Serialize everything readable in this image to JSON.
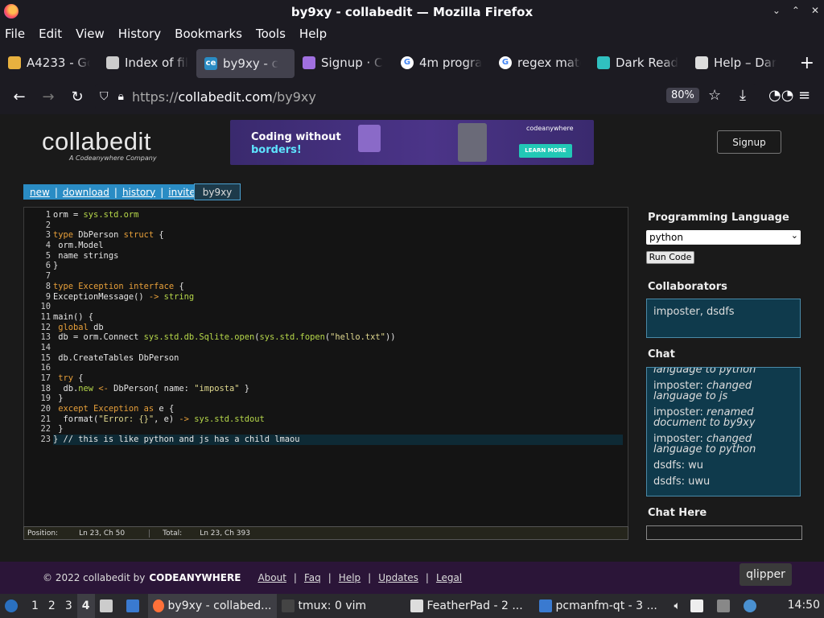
{
  "window": {
    "title": "by9xy - collabedit — Mozilla Firefox",
    "controls": [
      "⌄",
      "⌃",
      "✕"
    ]
  },
  "menubar": [
    "File",
    "Edit",
    "View",
    "History",
    "Bookmarks",
    "Tools",
    "Help"
  ],
  "tabs": [
    {
      "label": "A4233 - Go",
      "icon": "map-pin-icon",
      "color": "#e8b13f",
      "active": false
    },
    {
      "label": "Index of fil",
      "icon": "file-icon",
      "color": "#cccccc",
      "active": false
    },
    {
      "label": "by9xy - c",
      "icon": "ce",
      "color": "#2a8cc4",
      "active": true
    },
    {
      "label": "Signup · C",
      "icon": "cube-icon",
      "color": "#a070e0",
      "active": false
    },
    {
      "label": "4m progra",
      "icon": "G",
      "color": "#ffffff",
      "active": false
    },
    {
      "label": "regex matc",
      "icon": "G",
      "color": "#ffffff",
      "active": false
    },
    {
      "label": "Dark Read",
      "icon": "dark-reader-icon",
      "color": "#30c0c0",
      "active": false
    },
    {
      "label": "Help – Dar",
      "icon": "glasses-icon",
      "color": "#dddddd",
      "active": false
    }
  ],
  "navbar": {
    "url_prefix": "https://",
    "url_host": "collabedit.com",
    "url_path": "/by9xy",
    "zoom": "80%"
  },
  "page": {
    "logo_text": "collabedit",
    "logo_sub": "A Codeanywhere Company",
    "ad": {
      "line1": "Coding without",
      "line2": "borders!",
      "brand": "codeanywhere",
      "button": "LEARN MORE"
    },
    "signup": "Signup",
    "actions": [
      "new",
      "download",
      "history",
      "invite"
    ],
    "doc_name": "by9xy",
    "code_lines": [
      [
        [
          "t",
          "orm = "
        ],
        [
          "fn",
          "sys.std.orm"
        ]
      ],
      [],
      [
        [
          "kw",
          "type"
        ],
        [
          "t",
          " DbPerson "
        ],
        [
          "kw",
          "struct"
        ],
        [
          "t",
          " {"
        ]
      ],
      [
        [
          "t",
          " orm.Model"
        ]
      ],
      [
        [
          "t",
          " name strings"
        ]
      ],
      [
        [
          "t",
          "}"
        ]
      ],
      [],
      [
        [
          "kw",
          "type"
        ],
        [
          "t",
          " "
        ],
        [
          "kw",
          "Exception"
        ],
        [
          "t",
          " "
        ],
        [
          "kw",
          "interface"
        ],
        [
          "t",
          " {"
        ]
      ],
      [
        [
          "t",
          "ExceptionMessage() "
        ],
        [
          "kw",
          "->"
        ],
        [
          "t",
          " "
        ],
        [
          "fn",
          "string"
        ]
      ],
      [],
      [
        [
          "t",
          "main() {"
        ]
      ],
      [
        [
          "t",
          " "
        ],
        [
          "kw",
          "global"
        ],
        [
          "t",
          " db"
        ]
      ],
      [
        [
          "t",
          " db = orm.Connect "
        ],
        [
          "fn",
          "sys.std.db.Sqlite.open"
        ],
        [
          "t",
          "("
        ],
        [
          "fn",
          "sys.std.fopen"
        ],
        [
          "t",
          "("
        ],
        [
          "str",
          "\"hello.txt\""
        ],
        [
          "t",
          "))"
        ]
      ],
      [],
      [
        [
          "t",
          " db.CreateTables DbPerson"
        ]
      ],
      [],
      [
        [
          "t",
          " "
        ],
        [
          "kw",
          "try"
        ],
        [
          "t",
          " {"
        ]
      ],
      [
        [
          "t",
          "  db."
        ],
        [
          "fn",
          "new"
        ],
        [
          "t",
          " "
        ],
        [
          "kw",
          "<-"
        ],
        [
          "t",
          " DbPerson{ name: "
        ],
        [
          "str",
          "\"imposta\""
        ],
        [
          "t",
          " }"
        ]
      ],
      [
        [
          "t",
          " }"
        ]
      ],
      [
        [
          "t",
          " "
        ],
        [
          "kw",
          "except"
        ],
        [
          "t",
          " "
        ],
        [
          "kw",
          "Exception"
        ],
        [
          "t",
          " "
        ],
        [
          "kw",
          "as"
        ],
        [
          "t",
          " e {"
        ]
      ],
      [
        [
          "t",
          "  format("
        ],
        [
          "str",
          "\"Error: {}\""
        ],
        [
          "t",
          ", e) "
        ],
        [
          "kw",
          "->"
        ],
        [
          "t",
          " "
        ],
        [
          "fn",
          "sys.std.stdout"
        ]
      ],
      [
        [
          "t",
          " }"
        ]
      ],
      [
        [
          "t",
          "} // this is like python and js has a child lmaou"
        ]
      ]
    ],
    "status": {
      "position_label": "Position:",
      "position": "Ln 23, Ch 50",
      "total_label": "Total:",
      "total": "Ln 23, Ch 393"
    },
    "sidebar": {
      "lang_heading": "Programming Language",
      "lang_value": "python",
      "run_label": "Run Code",
      "collab_heading": "Collaborators",
      "collaborators": "imposter, dsdfs",
      "chat_heading": "Chat",
      "chat_messages": [
        {
          "user": "",
          "text": "language to python",
          "italic": true
        },
        {
          "user": "imposter: ",
          "text": "changed language to js",
          "italic": true
        },
        {
          "user": "imposter: ",
          "text": "renamed document to by9xy",
          "italic": true
        },
        {
          "user": "imposter: ",
          "text": "changed language to python",
          "italic": true
        },
        {
          "user": "dsdfs: ",
          "text": "wu",
          "italic": false
        },
        {
          "user": "dsdfs: ",
          "text": "uwu",
          "italic": false
        }
      ],
      "chat_here_heading": "Chat Here"
    },
    "footer": {
      "copyright": "© 2022 collabedit by",
      "company": "CODEANYWHERE",
      "links": [
        "About",
        "Faq",
        "Help",
        "Updates",
        "Legal"
      ]
    },
    "tooltip": "qlipper"
  },
  "taskbar": {
    "workspaces": [
      "1",
      "2",
      "3",
      "4"
    ],
    "tasks": [
      {
        "label": "by9xy - collabed...",
        "active": true
      },
      {
        "label": "tmux: 0 vim",
        "active": false
      },
      {
        "label": "FeatherPad - 2 ...",
        "active": false
      },
      {
        "label": "pcmanfm-qt - 3 ...",
        "active": false
      }
    ],
    "clock": "14:50"
  }
}
